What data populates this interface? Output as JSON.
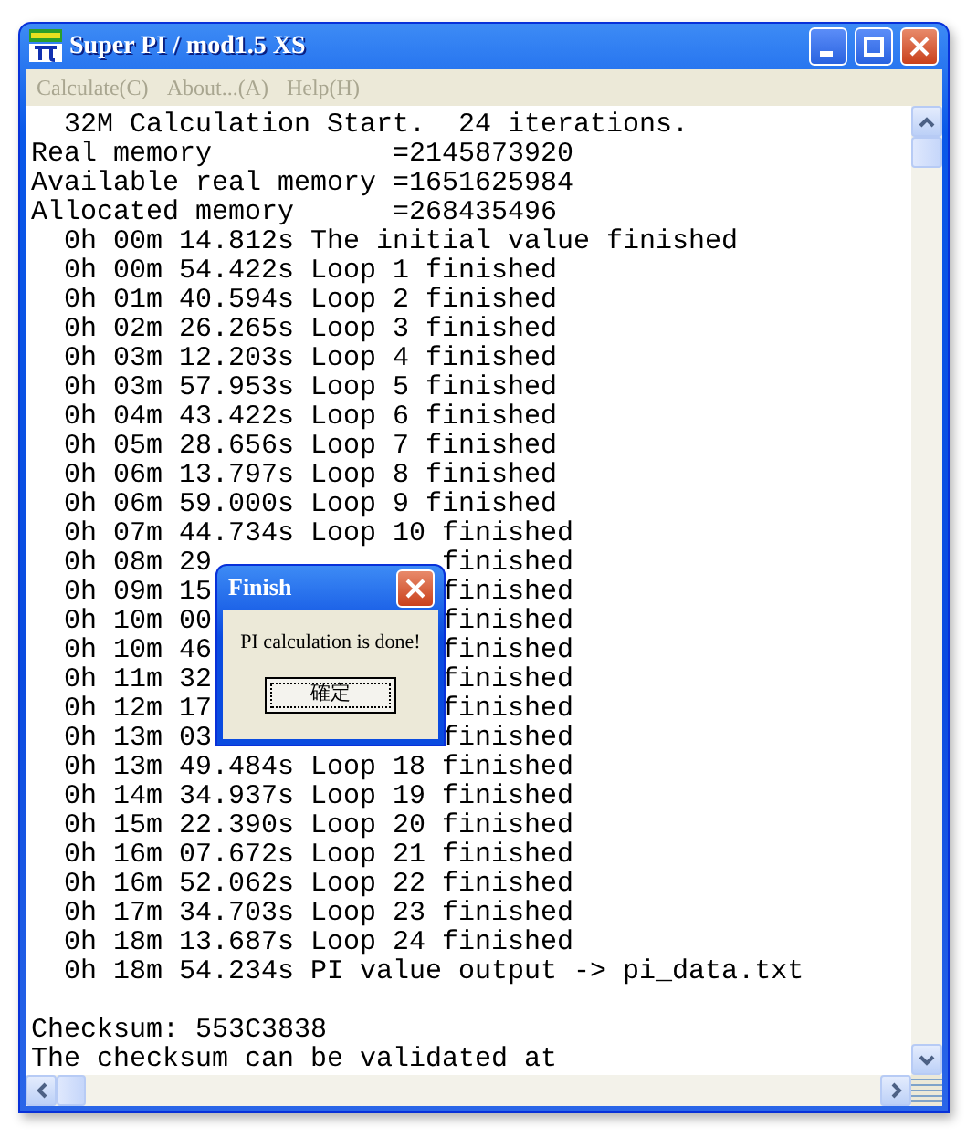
{
  "window": {
    "title": "Super PI / mod1.5 XS"
  },
  "menu": [
    {
      "label": "Calculate(C)",
      "disabled": true
    },
    {
      "label": "About...(A)",
      "disabled": true
    },
    {
      "label": "Help(H)",
      "disabled": true
    }
  ],
  "log": [
    {
      "kind": "full",
      "text": "  32M Calculation Start.  24 iterations."
    },
    {
      "kind": "full",
      "text": "Real memory           =2145873920"
    },
    {
      "kind": "full",
      "text": "Available real memory =1651625984"
    },
    {
      "kind": "full",
      "text": "Allocated memory      =268435496"
    },
    {
      "kind": "full",
      "text": "  0h 00m 14.812s The initial value finished"
    },
    {
      "kind": "full",
      "text": "  0h 00m 54.422s Loop 1 finished"
    },
    {
      "kind": "full",
      "text": "  0h 01m 40.594s Loop 2 finished"
    },
    {
      "kind": "full",
      "text": "  0h 02m 26.265s Loop 3 finished"
    },
    {
      "kind": "full",
      "text": "  0h 03m 12.203s Loop 4 finished"
    },
    {
      "kind": "full",
      "text": "  0h 03m 57.953s Loop 5 finished"
    },
    {
      "kind": "full",
      "text": "  0h 04m 43.422s Loop 6 finished"
    },
    {
      "kind": "full",
      "text": "  0h 05m 28.656s Loop 7 finished"
    },
    {
      "kind": "full",
      "text": "  0h 06m 13.797s Loop 8 finished"
    },
    {
      "kind": "full",
      "text": "  0h 06m 59.000s Loop 9 finished"
    },
    {
      "kind": "full",
      "text": "  0h 07m 44.734s Loop 10 finished"
    },
    {
      "kind": "split",
      "left": "  0h 08m 29",
      "right": "finished"
    },
    {
      "kind": "split",
      "left": "  0h 09m 15",
      "right": "finished"
    },
    {
      "kind": "split",
      "left": "  0h 10m 00",
      "right": "finished"
    },
    {
      "kind": "split",
      "left": "  0h 10m 46",
      "right": "finished"
    },
    {
      "kind": "split",
      "left": "  0h 11m 32",
      "right": "finished"
    },
    {
      "kind": "split",
      "left": "  0h 12m 17",
      "right": "finished"
    },
    {
      "kind": "split",
      "left": "  0h 13m 03",
      "right": "finished"
    },
    {
      "kind": "full",
      "text": "  0h 13m 49.484s Loop 18 finished"
    },
    {
      "kind": "full",
      "text": "  0h 14m 34.937s Loop 19 finished"
    },
    {
      "kind": "full",
      "text": "  0h 15m 22.390s Loop 20 finished"
    },
    {
      "kind": "full",
      "text": "  0h 16m 07.672s Loop 21 finished"
    },
    {
      "kind": "full",
      "text": "  0h 16m 52.062s Loop 22 finished"
    },
    {
      "kind": "full",
      "text": "  0h 17m 34.703s Loop 23 finished"
    },
    {
      "kind": "full",
      "text": "  0h 18m 13.687s Loop 24 finished"
    },
    {
      "kind": "full",
      "text": "  0h 18m 54.234s PI value output -> pi_data.txt"
    },
    {
      "kind": "blank"
    },
    {
      "kind": "full",
      "text": "Checksum: 553C3838"
    },
    {
      "kind": "full",
      "text": "The checksum can be validated at"
    }
  ],
  "dialog": {
    "title": "Finish",
    "message": "PI calculation is done!",
    "button": "確定"
  }
}
